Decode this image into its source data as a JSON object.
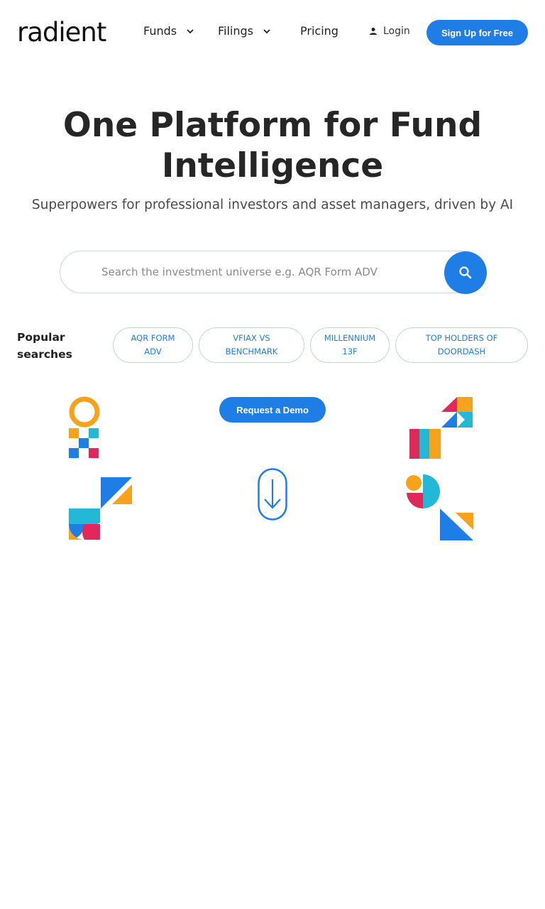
{
  "brand": {
    "logo_text": "radient",
    "accent": "#1f7de6"
  },
  "nav": {
    "funds_label": "Funds",
    "filings_label": "Filings",
    "pricing_label": "Pricing",
    "login_label": "Login",
    "signup_label": "Sign Up for Free"
  },
  "hero": {
    "title_line1": "One Platform for Fund",
    "title_line2": "Intelligence",
    "subtitle": "Superpowers for professional investors and asset managers, driven by AI"
  },
  "search": {
    "placeholder": "Search the investment universe e.g. AQR Form ADV",
    "value": ""
  },
  "popular": {
    "label": "Popular searches",
    "chips": [
      {
        "line1": "AQR FORM",
        "line2": "ADV"
      },
      {
        "line1": "VFIAX VS",
        "line2": "BENCHMARK"
      },
      {
        "line1": "MILLENNIUM",
        "line2": "13F"
      },
      {
        "line1": "TOP HOLDERS OF",
        "line2": "DOORDASH"
      }
    ]
  },
  "cta": {
    "demo_label": "Request a Demo"
  },
  "palette": {
    "orange": "#f7a21b",
    "blue": "#1f7de6",
    "cyan": "#22b8d6",
    "red": "#e0285a"
  }
}
